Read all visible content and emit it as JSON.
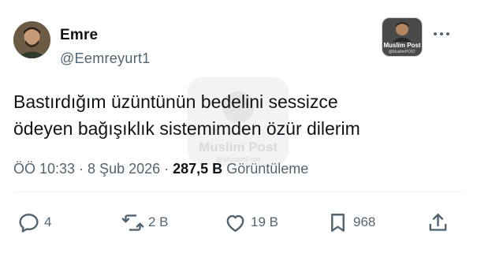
{
  "author": {
    "name": "Emre",
    "handle": "@Eemreyurt1"
  },
  "badge": {
    "title": "Muslim Post",
    "subtitle": "@MuslimPOST"
  },
  "watermark": {
    "title": "Muslim Post",
    "subtitle": "@MuslimPost"
  },
  "tweet": {
    "lines": [
      "Bastırdığım üzüntünün bedelini sessizce",
      "ödeyen bağışıklık sistemimden özür dilerim"
    ]
  },
  "meta": {
    "time": "ÖÖ 10:33",
    "date": "8 Şub 2026",
    "separator": "·",
    "views_count": "287,5 B",
    "views_label": "Görüntüleme"
  },
  "actions": {
    "replies": "4",
    "retweets": "2 B",
    "likes": "19 B",
    "bookmarks": "968"
  },
  "icons": [
    "more-icon",
    "reply-icon",
    "retweet-icon",
    "like-icon",
    "bookmark-icon",
    "share-icon"
  ],
  "colors": {
    "text": "#0f1419",
    "secondary": "#536471",
    "divider": "#eff3f4"
  }
}
